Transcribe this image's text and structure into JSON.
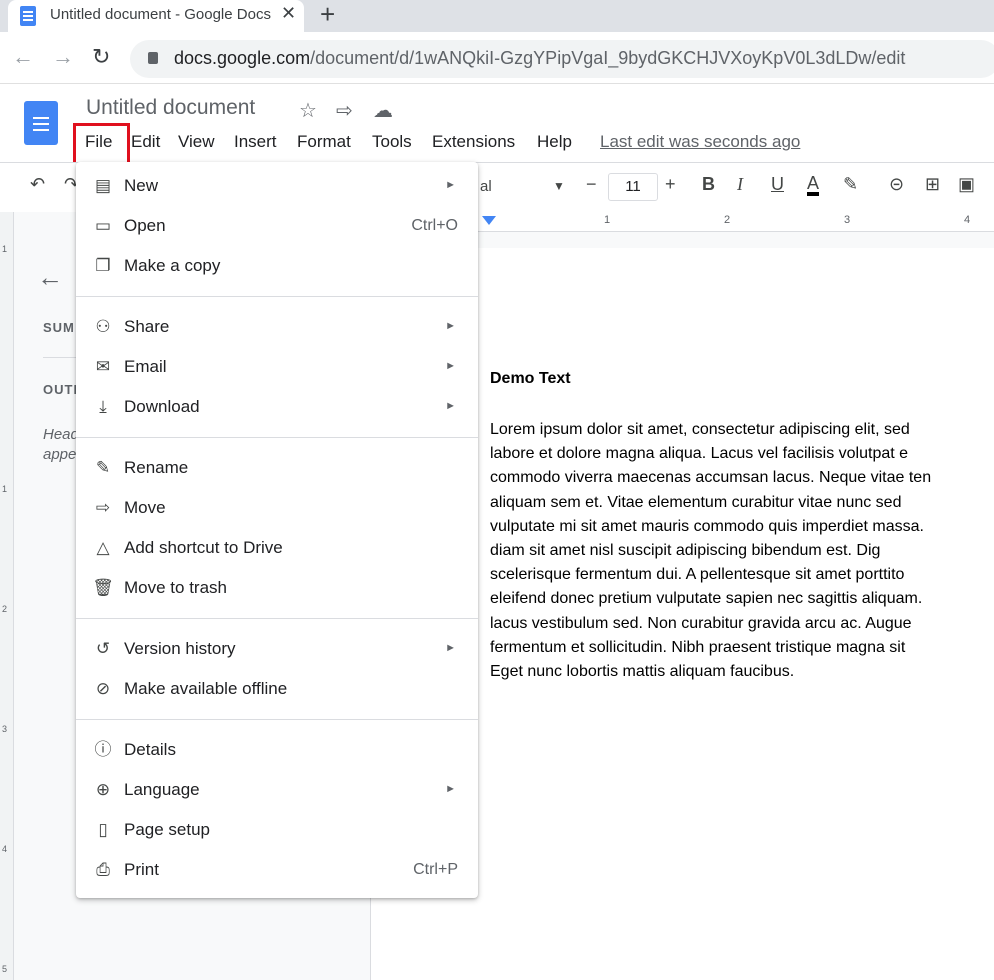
{
  "browser": {
    "tab_title": "Untitled document - Google Docs",
    "tab_close": "✕",
    "new_tab": "+",
    "url_host": "docs.google.com",
    "url_path": "/document/d/1wANQkiI-GzgYPipVgaI_9bydGKCHJVXoyKpV0L3dLDw/edit"
  },
  "docs": {
    "title": "Untitled document",
    "menu": [
      "File",
      "Edit",
      "View",
      "Insert",
      "Format",
      "Tools",
      "Extensions",
      "Help"
    ],
    "last_edit": "Last edit was seconds ago",
    "font_fragment": "al",
    "font_size": "11",
    "outline": {
      "summary_label": "SUM",
      "outline_label": "OUTL",
      "hint": "Head appe"
    },
    "ruler_ticks": [
      "1",
      "2",
      "3",
      "4"
    ],
    "vertical_ticks": [
      "1",
      "1",
      "2",
      "3",
      "4",
      "5"
    ]
  },
  "document": {
    "heading": "Demo Text",
    "lines": [
      "Lorem ipsum dolor sit amet, consectetur adipiscing elit, sed",
      "labore et dolore magna aliqua. Lacus vel facilisis volutpat e",
      "commodo viverra maecenas accumsan lacus. Neque vitae ten",
      "aliquam sem et. Vitae elementum curabitur vitae nunc sed",
      "vulputate mi sit amet mauris commodo quis imperdiet massa.",
      "diam sit amet nisl suscipit adipiscing bibendum est. Dig",
      "scelerisque fermentum dui. A pellentesque sit amet porttito",
      "eleifend donec pretium vulputate sapien nec sagittis aliquam.",
      "lacus vestibulum sed. Non curabitur gravida arcu ac. Augue",
      "fermentum et sollicitudin. Nibh praesent tristique magna sit",
      "Eget nunc lobortis mattis aliquam faucibus."
    ]
  },
  "file_menu": {
    "items": [
      {
        "label": "New",
        "icon": "new-doc-icon",
        "submenu": true
      },
      {
        "label": "Open",
        "icon": "folder-icon",
        "shortcut": "Ctrl+O"
      },
      {
        "label": "Make a copy",
        "icon": "copy-icon"
      },
      {
        "label": "Share",
        "icon": "share-person-icon",
        "submenu": true
      },
      {
        "label": "Email",
        "icon": "email-icon",
        "submenu": true
      },
      {
        "label": "Download",
        "icon": "download-icon",
        "submenu": true
      },
      {
        "label": "Rename",
        "icon": "rename-icon"
      },
      {
        "label": "Move",
        "icon": "move-folder-icon"
      },
      {
        "label": "Add shortcut to Drive",
        "icon": "drive-shortcut-icon"
      },
      {
        "label": "Move to trash",
        "icon": "trash-icon"
      },
      {
        "label": "Version history",
        "icon": "history-icon",
        "submenu": true
      },
      {
        "label": "Make available offline",
        "icon": "offline-icon"
      },
      {
        "label": "Details",
        "icon": "info-icon"
      },
      {
        "label": "Language",
        "icon": "globe-icon",
        "submenu": true
      },
      {
        "label": "Page setup",
        "icon": "page-setup-icon"
      },
      {
        "label": "Print",
        "icon": "print-icon",
        "shortcut": "Ctrl+P"
      }
    ]
  },
  "colors": {
    "highlight_border": "#e0101e",
    "docs_blue": "#4285f4"
  }
}
